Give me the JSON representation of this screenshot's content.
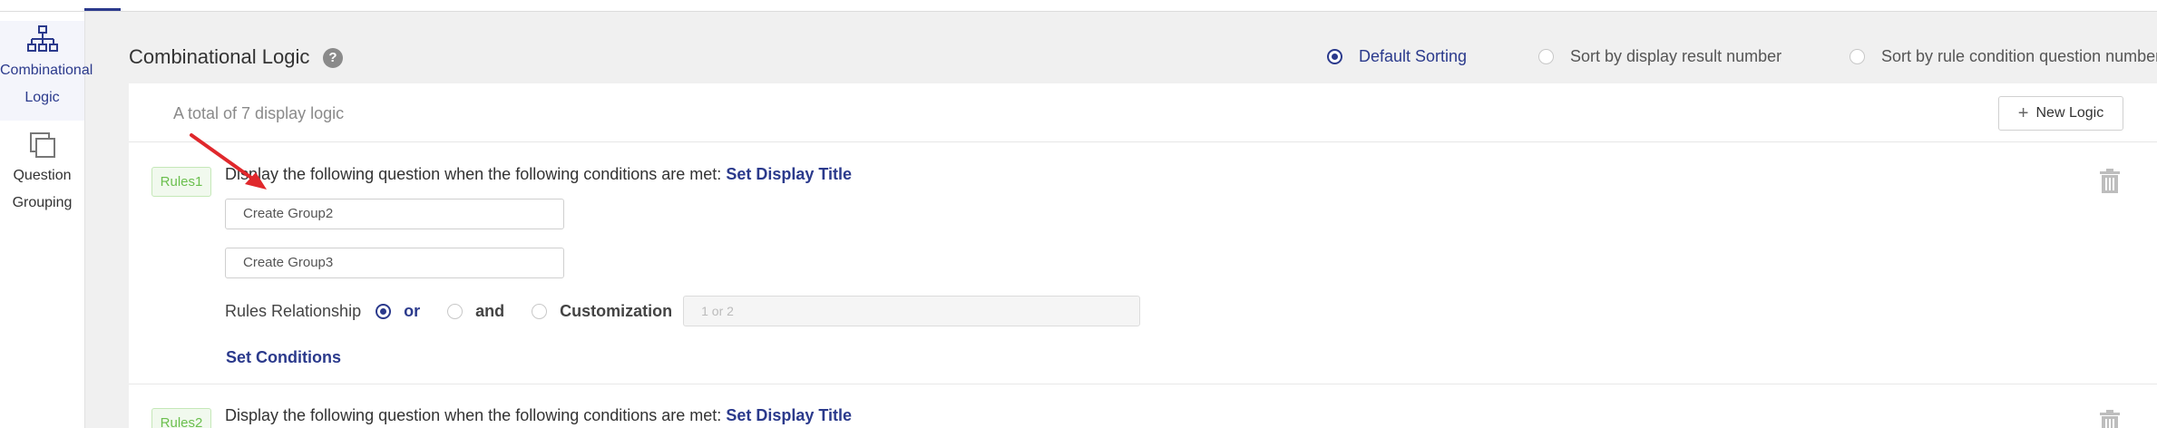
{
  "sidebar": {
    "items": [
      {
        "label_line1": "Combinational",
        "label_line2": "Logic",
        "icon": "org-chart-icon",
        "active": true
      },
      {
        "label_line1": "Question",
        "label_line2": "Grouping",
        "icon": "stack-icon",
        "active": false
      }
    ]
  },
  "header": {
    "title": "Combinational Logic",
    "help_glyph": "?",
    "sort_options": [
      {
        "label": "Default Sorting",
        "selected": true
      },
      {
        "label": "Sort by display result number",
        "selected": false
      },
      {
        "label": "Sort by rule condition question number",
        "selected": false
      }
    ]
  },
  "panel": {
    "total_text": "A total of 7 display logic",
    "new_logic_label": "New Logic"
  },
  "rules": [
    {
      "tag": "Rules1",
      "description": "Display the following question when the following conditions are met:",
      "set_title_label": "Set Display Title",
      "groups": [
        "Create Group2",
        "Create Group3"
      ],
      "relationship_label": "Rules Relationship",
      "relationship_options": [
        {
          "label": "or",
          "selected": true
        },
        {
          "label": "and",
          "selected": false
        },
        {
          "label": "Customization",
          "selected": false
        }
      ],
      "custom_placeholder": "1 or 2",
      "set_conditions_label": "Set Conditions"
    },
    {
      "tag": "Rules2",
      "description": "Display the following question when the following conditions are met:",
      "set_title_label": "Set Display Title"
    }
  ],
  "colors": {
    "accent": "#2b3a8c",
    "tag_green": "#6bbf4e",
    "annotation_arrow": "#e0282c"
  }
}
